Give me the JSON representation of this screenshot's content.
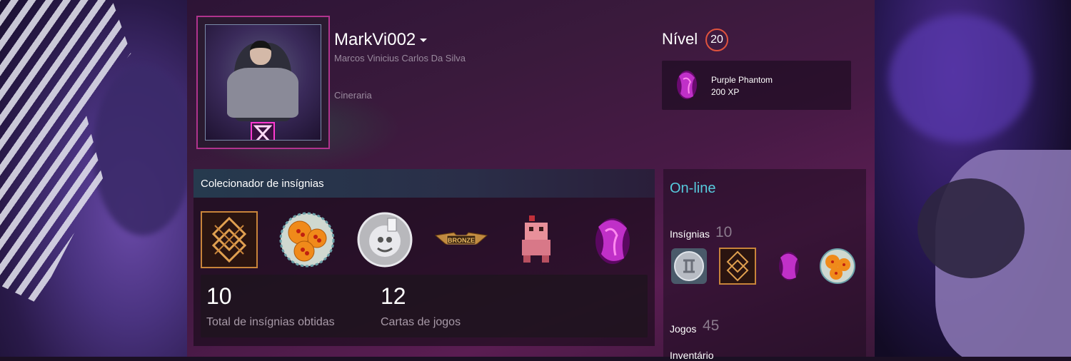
{
  "profile": {
    "username": "MarkVi002",
    "real_name": "Marcos Vinicius Carlos Da Silva",
    "location": "Cineraria"
  },
  "level": {
    "label": "Nível",
    "value": "20",
    "favorite_badge": {
      "name": "Purple Phantom",
      "xp": "200 XP",
      "icon": "purple-phantom-icon"
    }
  },
  "badge_collector": {
    "title": "Colecionador de insígnias",
    "badges": [
      {
        "icon": "golden-rune-badge-icon"
      },
      {
        "icon": "dragon-balls-badge-icon"
      },
      {
        "icon": "silver-cuphead-badge-icon"
      },
      {
        "icon": "bronze-wings-badge-icon",
        "text": "BRONZE"
      },
      {
        "icon": "pixel-creature-badge-icon"
      },
      {
        "icon": "purple-phantom-badge-icon"
      }
    ],
    "stats": [
      {
        "value": "10",
        "label": "Total de insígnias obtidas"
      },
      {
        "value": "12",
        "label": "Cartas de jogos"
      }
    ]
  },
  "sidebar": {
    "status": "On-line",
    "badges_label": "Insígnias",
    "badges_count": "10",
    "badge_icons": [
      "silver-coin-badge-icon",
      "golden-rune-badge-icon",
      "purple-phantom-badge-icon",
      "dragon-balls-badge-icon"
    ],
    "games_label": "Jogos",
    "games_count": "45",
    "inventory_label": "Inventário"
  },
  "colors": {
    "online": "#57cbde",
    "level_ring": "#e0533e",
    "avatar_border": "#b0338e"
  }
}
